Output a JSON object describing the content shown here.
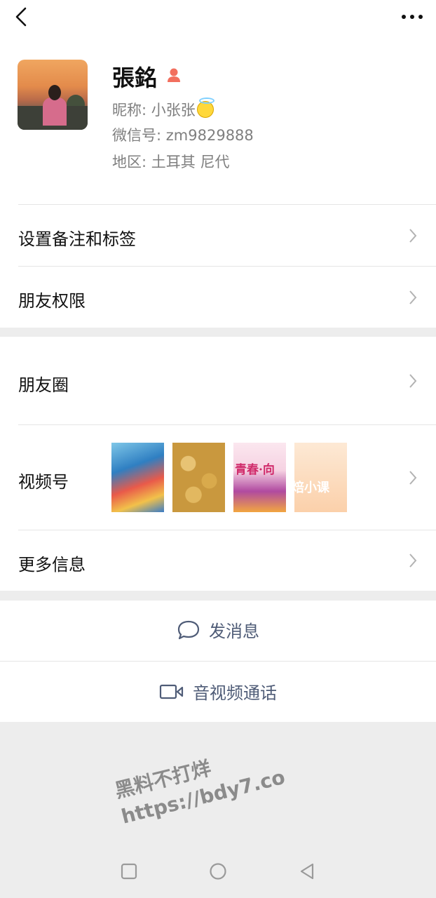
{
  "profile": {
    "name": "張銘",
    "nickname_label": "昵称: ",
    "nickname": "小张张",
    "wechat_label": "微信号: ",
    "wechat_id": "zm9829888",
    "region_label": "地区: ",
    "region": "土耳其  尼代",
    "gender_icon": "female-icon"
  },
  "menu": {
    "remark": "设置备注和标签",
    "permissions": "朋友权限",
    "moments": "朋友圈",
    "channels": "视频号",
    "more_info": "更多信息"
  },
  "thumbs": {
    "t3_text": "青春·向",
    "t4_text": "焙小课"
  },
  "actions": {
    "message": "发消息",
    "call": "音视频通话"
  },
  "watermark": {
    "line1": "黑料不打烊",
    "line2": "https://bdy7.co"
  },
  "colors": {
    "background": "#ededed",
    "action_text": "#4f5c77",
    "secondary_text": "#7f7f7f"
  }
}
